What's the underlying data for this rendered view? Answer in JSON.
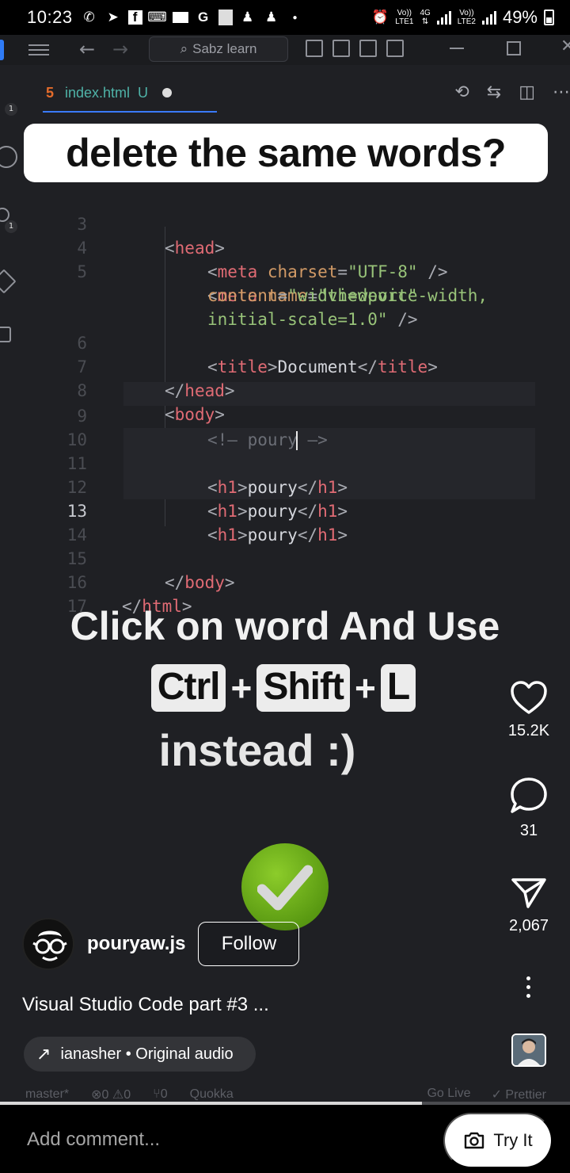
{
  "status_bar": {
    "time": "10:23",
    "net1_top": "Vo))",
    "net1_bottom": "LTE1",
    "net_type": "4G",
    "net2_top": "Vo))",
    "net2_bottom": "LTE2",
    "battery": "49%"
  },
  "vscode": {
    "search_text": "Sabz learn",
    "tab": {
      "file": "index.html",
      "status": "U"
    },
    "caption": "delete the same words?",
    "lines": [
      {
        "n": "3"
      },
      {
        "n": "4"
      },
      {
        "n": "5"
      },
      {
        "n": "6"
      },
      {
        "n": "7"
      },
      {
        "n": "8"
      },
      {
        "n": "9"
      },
      {
        "n": "10"
      },
      {
        "n": "11"
      },
      {
        "n": "12"
      },
      {
        "n": "13"
      },
      {
        "n": "14"
      },
      {
        "n": "15"
      },
      {
        "n": "16"
      },
      {
        "n": "17"
      }
    ],
    "code": {
      "l3_tag": "head",
      "l4_tag": "meta",
      "l4_attr": "charset",
      "l4_val": "\"UTF-8\"",
      "l5_tag": "meta",
      "l5_attr": "name",
      "l5_val": "\"viewport\"",
      "l5b_attr": "content",
      "l5b_val": "\"width=device-width,",
      "l5c_val": "initial-scale=1.0\"",
      "l6_tag": "title",
      "l6_text": "Document",
      "l7_tag": "head",
      "l8_tag": "body",
      "l9_comment_open": "<!—",
      "l9_text": "poury",
      "l9_comment_close": "—>",
      "h1_tag": "h1",
      "h1_text": "poury",
      "l15_tag": "body",
      "l16_tag": "html"
    },
    "statusline": {
      "branch": "master*",
      "errors": "⊗0 ⚠0",
      "ports": "⑂0",
      "quokka": "Quokka",
      "golive": "Go Live",
      "prettier": "✓ Prettier"
    }
  },
  "overlay": {
    "line1": "Click on word And Use",
    "key1": "Ctrl",
    "plus": "+",
    "key2": "Shift",
    "key3": "L",
    "line3": "instead :)"
  },
  "reel": {
    "likes": "15.2K",
    "comments": "31",
    "shares": "2,067",
    "username": "pouryaw.js",
    "follow_label": "Follow",
    "description": "Visual Studio Code part #3 ...",
    "audio": "ianasher • Original audio",
    "progress": 0.74,
    "comment_placeholder": "Add comment...",
    "try_it": "Try It"
  }
}
